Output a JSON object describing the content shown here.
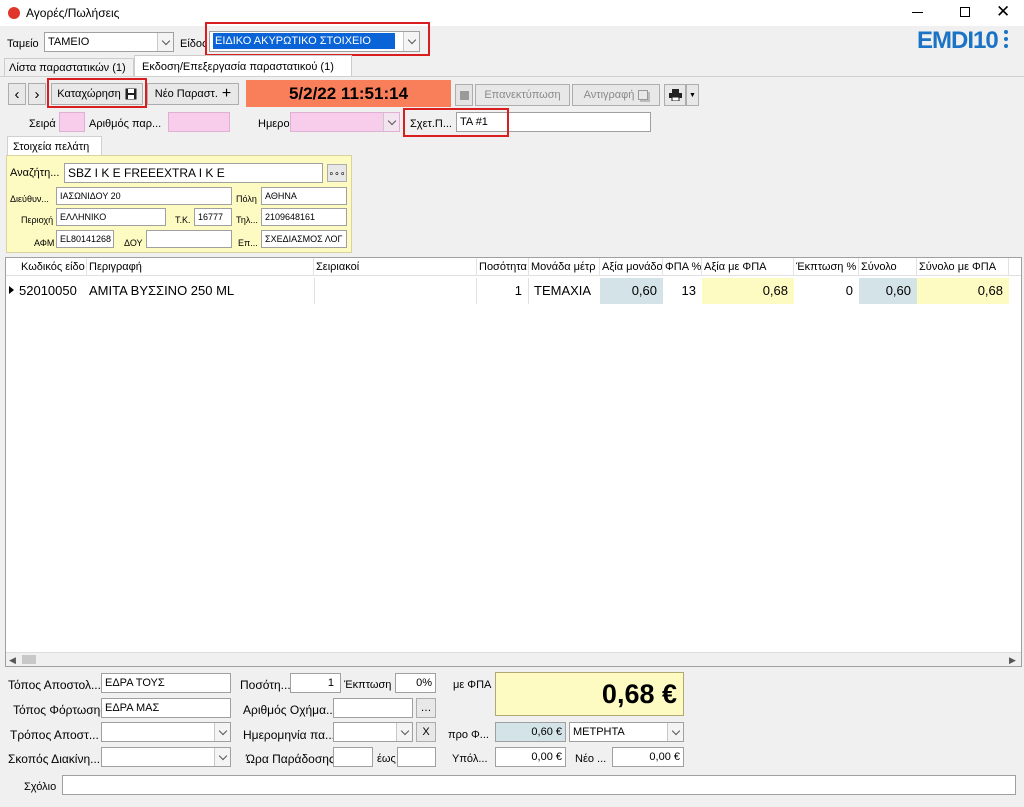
{
  "window": {
    "title": "Αγορές/Πωλήσεις"
  },
  "brand": {
    "logo": "EMDI10"
  },
  "header": {
    "tameio_label": "Ταμείο",
    "tameio_value": "ΤΑΜΕΙΟ",
    "eidos_label": "Είδος",
    "eidos_value": "ΕΙΔΙΚΟ ΑΚΥΡΩΤΙΚΟ ΣΤΟΙΧΕΙΟ"
  },
  "tabs": [
    {
      "label": "Λίστα παραστατικών (1)"
    },
    {
      "label": "Εκδοση/Επεξεργασία παραστατικού (1)"
    }
  ],
  "toolbar": {
    "save_label": "Καταχώρηση",
    "new_label": "Νέο Παραστ.",
    "datetime": "5/2/22 11:51:14",
    "reprint_label": "Επανεκτύπωση",
    "copy_label": "Αντιγραφή"
  },
  "doc": {
    "seira_label": "Σειρά",
    "arithmos_label": "Αριθμός παρ...",
    "hmero_label": "Ημερο...",
    "sxet_label": "Σχετ.Π...",
    "sxet_value": "ΤΑ #1"
  },
  "customer": {
    "tab_label": "Στοιχεία πελάτη",
    "search_label": "Αναζήτη...",
    "search_value": "SBZ I K E  FREEEXTRA I K E",
    "address_label": "Διεύθυν...",
    "address_value": "ΙΑΣΩΝΙΔΟΥ 20",
    "city_label": "Πόλη",
    "city_value": "ΑΘΗΝΑ",
    "area_label": "Περιοχή",
    "area_value": "ΕΛΛΗΝΙΚΟ",
    "tk_label": "Τ.Κ.",
    "tk_value": "16777",
    "phone_label": "Τηλ...",
    "phone_value": "2109648161",
    "afm_label": "ΑΦΜ",
    "afm_value": "EL80141268",
    "doy_label": "ΔΟΥ",
    "doy_value": "",
    "epag_label": "Επ...",
    "epag_value": "ΣΧΕΔΙΑΣΜΟΣ ΛΟΓ"
  },
  "grid": {
    "columns": [
      "Κωδικός είδο",
      "Περιγραφή",
      "Σειριακοί",
      "Ποσότητα",
      "Μονάδα μέτρ",
      "Αξία μονάδο",
      "ΦΠΑ %",
      "Αξία με ΦΠΑ",
      "Έκπτωση %",
      "Σύνολο",
      "Σύνολο με ΦΠΑ"
    ],
    "rows": [
      {
        "code": "52010050",
        "desc": "ΑΜΙΤΑ ΒΥΣΣΙΝΟ 250 ML",
        "serial": "",
        "qty": "1",
        "unit": "ΤΕΜΑΧΙΑ",
        "unit_value": "0,60",
        "vat": "13",
        "value_vat": "0,68",
        "discount": "0",
        "total": "0,60",
        "total_vat": "0,68"
      }
    ]
  },
  "footer": {
    "topos_apost_label": "Τόπος Αποστολ...",
    "topos_apost_value": "ΕΔΡΑ ΤΟΥΣ",
    "topos_fort_label": "Τόπος Φόρτωσης",
    "topos_fort_value": "ΕΔΡΑ ΜΑΣ",
    "tropos_label": "Τρόπος Αποστ...",
    "skopos_label": "Σκοπός Διακίνη...",
    "posot_label": "Ποσότη...",
    "posot_value": "1",
    "ekptosi_label": "Έκπτωση",
    "ekptosi_value": "0%",
    "oxima_label": "Αριθμός Οχήμα...",
    "date_label": "Ημερομηνία πα...",
    "x_label": "X",
    "ora_label": "Ώρα Παράδοσης",
    "eos_label": "έως",
    "mefpa_label": "με ΦΠΑ",
    "total": "0,68 €",
    "pro_label": "προ Φ...",
    "pro_value": "0,60 €",
    "payment": "ΜΕΤΡΗΤΑ",
    "ypol_label": "Υπόλ...",
    "ypol_value": "0,00 €",
    "neo_label": "Νέο ...",
    "neo_value": "0,00 €",
    "sxolio_label": "Σχόλιο"
  },
  "colors": {
    "accent_red": "#d81e1e",
    "datetime_bg": "#f97e5a",
    "yellow": "#fdfbc2",
    "pink": "#f7cdeb",
    "selection": "#0a64d8",
    "logo_blue": "#1b73c5"
  }
}
